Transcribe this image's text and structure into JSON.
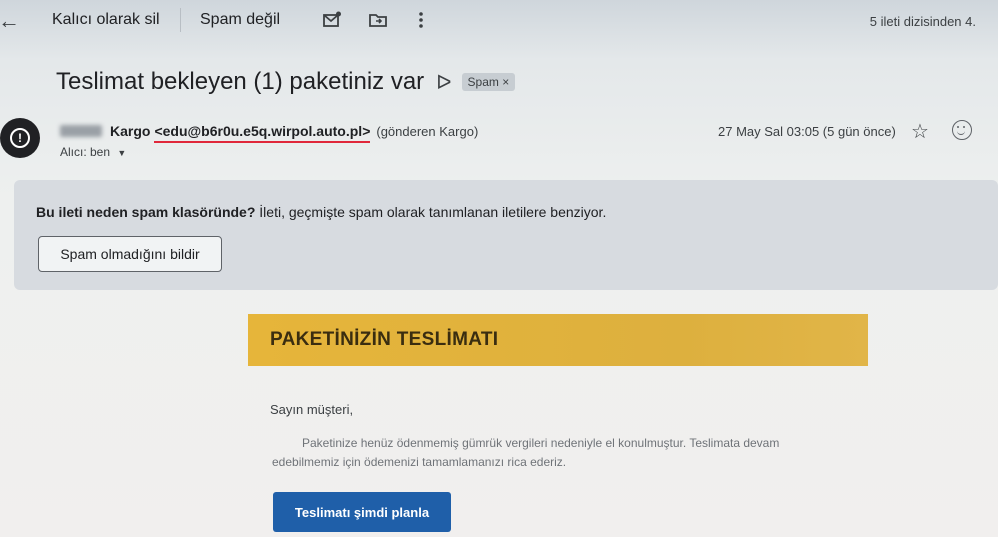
{
  "toolbar": {
    "delete_forever": "Kalıcı olarak sil",
    "not_spam": "Spam değil",
    "thread_count": "5 ileti dizisinden 4."
  },
  "message": {
    "subject": "Teslimat bekleyen (1) paketiniz var",
    "spam_chip": "Spam ×",
    "sender_name": "Kargo",
    "sender_email": "<edu@b6r0u.e5q.wirpol.auto.pl>",
    "sender_via": "(gönderen Kargo)",
    "recipient": "Alıcı: ben",
    "date": "27 May Sal 03:05 (5 gün önce)"
  },
  "spam_banner": {
    "question": "Bu ileti neden spam klasöründe?",
    "explanation": " İleti, geçmişte spam olarak tanımlanan iletilere benziyor.",
    "report_button": "Spam olmadığını bildir"
  },
  "email_content": {
    "banner_title": "PAKETİNİZİN TESLİMATI",
    "greeting": "Sayın müşteri,",
    "paragraph": "Paketinize henüz ödenmemiş gümrük vergileri nedeniyle el konulmuştur. Teslimata devam edebilmemiz için ödemenizi tamamlamanızı rica ederiz.",
    "cta_button": "Teslimatı şimdi planla"
  },
  "colors": {
    "banner_gold": "#e6b53a",
    "cta_blue": "#1f5fa9",
    "underline_red": "#e0283b"
  }
}
